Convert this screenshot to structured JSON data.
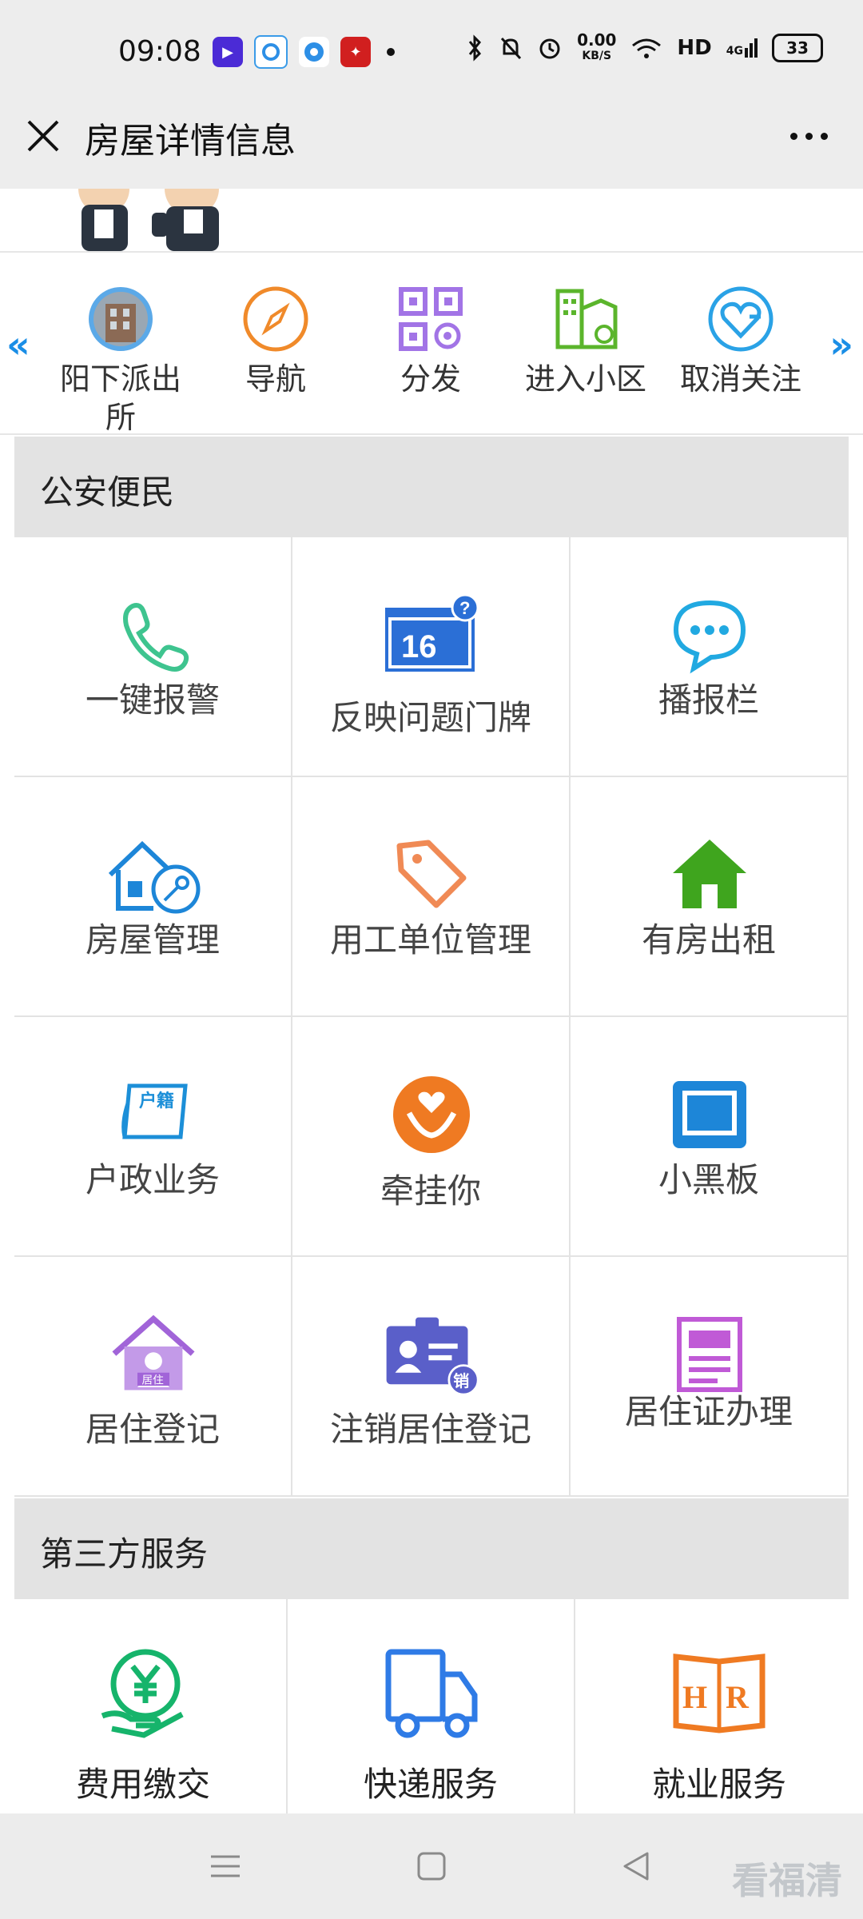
{
  "status_bar": {
    "time": "09:08",
    "net_speed_value": "0.00",
    "net_speed_unit": "KB/S",
    "hd": "HD",
    "signal": "4G",
    "battery": "33"
  },
  "header": {
    "title": "房屋详情信息"
  },
  "quick_actions": [
    {
      "label": "阳下派出所",
      "icon": "police-station-photo-icon"
    },
    {
      "label": "导航",
      "icon": "compass-icon"
    },
    {
      "label": "分发",
      "icon": "qr-code-icon"
    },
    {
      "label": "进入小区",
      "icon": "building-map-icon"
    },
    {
      "label": "取消关注",
      "icon": "heart-icon"
    }
  ],
  "sections": {
    "police": {
      "title": "公安便民",
      "items": [
        {
          "label": "一键报警",
          "icon": "phone-icon",
          "color": "#3ec48f"
        },
        {
          "label": "反映问题门牌",
          "icon": "door-plate-icon",
          "color": "#2b6fd6"
        },
        {
          "label": "播报栏",
          "icon": "chat-bubble-icon",
          "color": "#21a9e1"
        },
        {
          "label": "房屋管理",
          "icon": "house-key-icon",
          "color": "#1d86d8"
        },
        {
          "label": "用工单位管理",
          "icon": "tag-icon",
          "color": "#f08a55"
        },
        {
          "label": "有房出租",
          "icon": "house-icon",
          "color": "#3fa51e"
        },
        {
          "label": "户政业务",
          "icon": "household-register-icon",
          "color": "#1c8fd8"
        },
        {
          "label": "牵挂你",
          "icon": "heart-hands-icon",
          "color": "#ef7a22"
        },
        {
          "label": "小黑板",
          "icon": "blackboard-icon",
          "color": "#1d86d8"
        },
        {
          "label": "居住登记",
          "icon": "residence-house-icon",
          "color": "#a164d8"
        },
        {
          "label": "注销居住登记",
          "icon": "id-card-cancel-icon",
          "color": "#5a5fc9"
        },
        {
          "label": "居住证办理",
          "icon": "document-icon",
          "color": "#c05ad6"
        }
      ]
    },
    "third_party": {
      "title": "第三方服务",
      "items": [
        {
          "label": "费用缴交",
          "icon": "yuan-hand-icon",
          "color": "#16b46b"
        },
        {
          "label": "快递服务",
          "icon": "delivery-truck-icon",
          "color": "#2f7be6"
        },
        {
          "label": "就业服务",
          "icon": "hr-book-icon",
          "color": "#ef7a22"
        }
      ]
    }
  },
  "watermark": "看福清"
}
